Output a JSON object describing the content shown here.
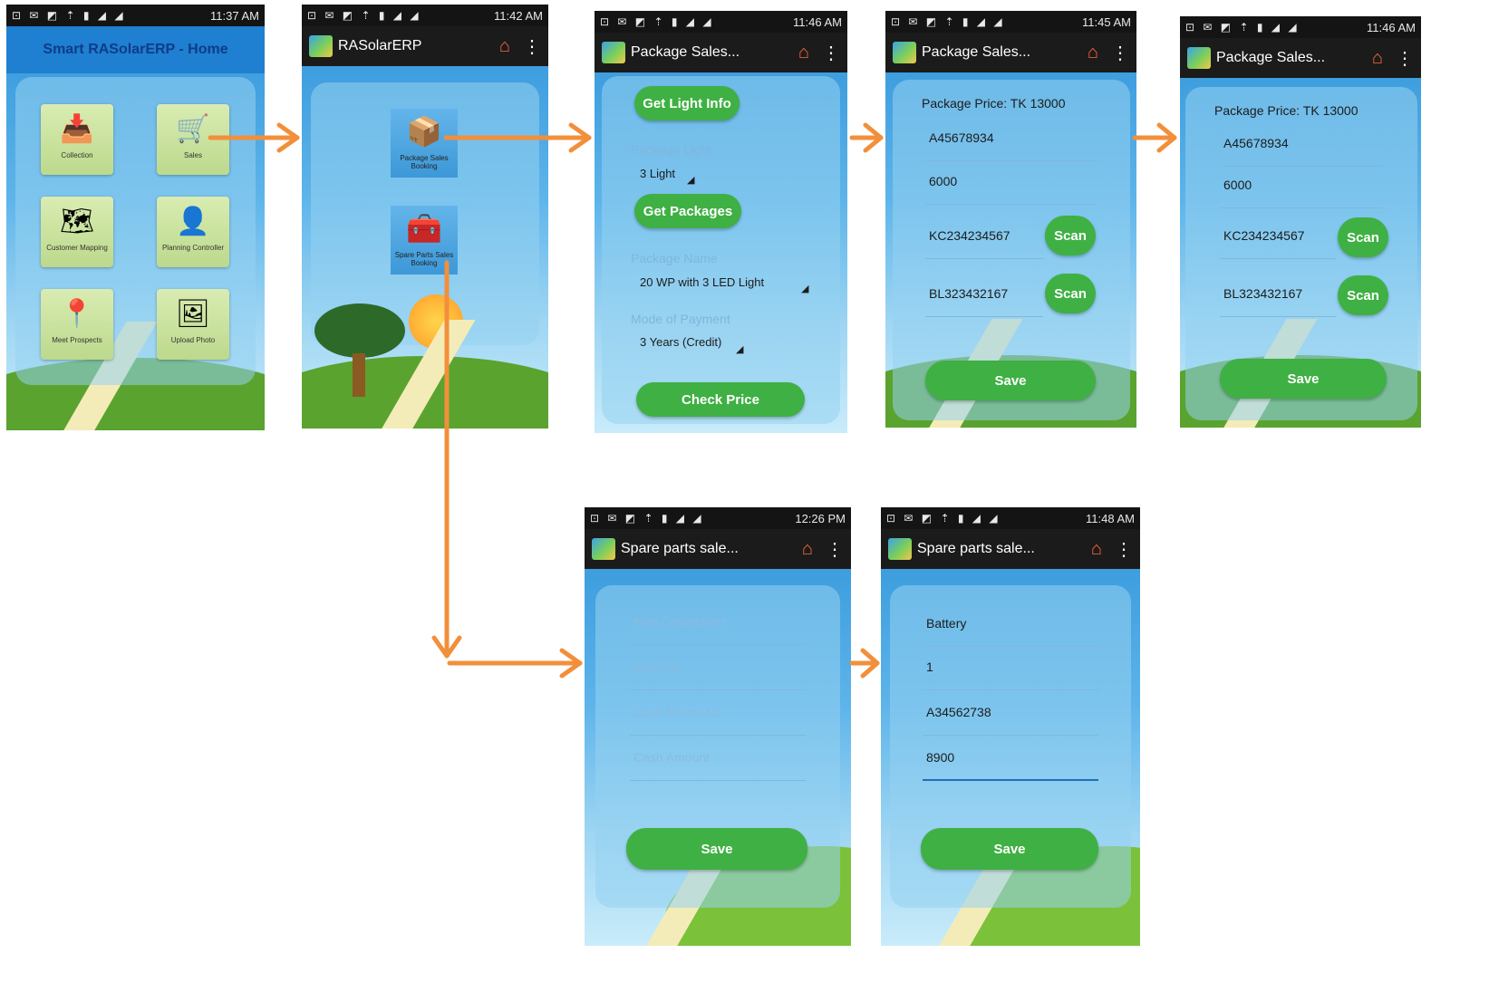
{
  "arrow_color": "#f28f3b",
  "accent_green": "#3fb043",
  "status_icons": "⊡ ✉ ◩ ⇡ ▮ ◢ ◢",
  "screens": {
    "home": {
      "time": "11:37 AM",
      "title": "Smart RASolarERP - Home",
      "tiles": [
        {
          "label": "Collection",
          "icon": "collection-icon",
          "glyph": "📥"
        },
        {
          "label": "Sales",
          "icon": "cart-icon",
          "glyph": "🛒"
        },
        {
          "label": "Customer Mapping",
          "icon": "map-pins-icon",
          "glyph": "🗺"
        },
        {
          "label": "Planning Controller",
          "icon": "planning-icon",
          "glyph": "👤"
        },
        {
          "label": "Meet Prospects",
          "icon": "prospect-icon",
          "glyph": "📍"
        },
        {
          "label": "Upload Photo",
          "icon": "photo-upload-icon",
          "glyph": "🖼"
        }
      ]
    },
    "sales_menu": {
      "time": "11:42 AM",
      "title": "RASolarERP",
      "tiles": [
        {
          "label": "Package Sales Booking",
          "icon": "package-box-icon",
          "glyph": "📦"
        },
        {
          "label": "Spare Parts Sales Booking",
          "icon": "spare-parts-icon",
          "glyph": "🧰"
        }
      ]
    },
    "package_form": {
      "time": "11:46 AM",
      "title": "Package Sales...",
      "get_light_info": "Get Light Info",
      "package_light_label": "Package Light",
      "package_light_value": "3 Light",
      "get_packages": "Get Packages",
      "package_name_label": "Package Name",
      "package_name_value": "20 WP with 3 LED Light",
      "mode_label": "Mode of Payment",
      "mode_value": "3 Years (Credit)",
      "check_price": "Check Price"
    },
    "package_price_1": {
      "time": "11:45 AM",
      "title": "Package Sales...",
      "price": "Package Price: TK 13000",
      "customer": "A45678934",
      "amount": "6000",
      "serial1": "KC234234567",
      "serial2": "BL323432167",
      "scan": "Scan",
      "save": "Save"
    },
    "package_price_2": {
      "time": "11:46 AM",
      "title": "Package Sales...",
      "price": "Package Price: TK 13000",
      "customer": "A45678934",
      "amount": "6000",
      "serial1": "KC234234567",
      "serial2": "BL323432167",
      "scan": "Scan",
      "save": "Save"
    },
    "spare_empty": {
      "time": "12:26 PM",
      "title": "Spare parts sale...",
      "ph_desc": "Item Description",
      "ph_qty": "Item Qty",
      "ph_memo": "Cash Memo No",
      "ph_amount": "Cash Amount",
      "save": "Save"
    },
    "spare_filled": {
      "time": "11:48 AM",
      "title": "Spare parts sale...",
      "desc": "Battery",
      "qty": "1",
      "memo": "A34562738",
      "amount": "8900",
      "save": "Save"
    }
  }
}
